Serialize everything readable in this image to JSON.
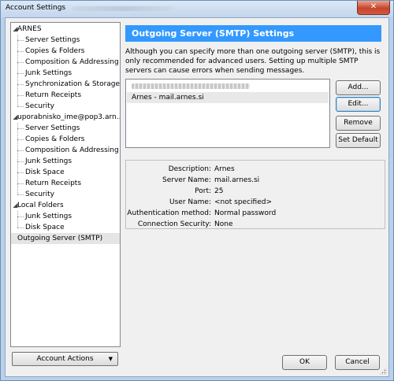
{
  "window": {
    "title": "Account Settings",
    "close_glyph": "✕"
  },
  "tree": {
    "accounts": [
      {
        "name": "ARNES",
        "children": [
          "Server Settings",
          "Copies & Folders",
          "Composition & Addressing",
          "Junk Settings",
          "Synchronization & Storage",
          "Return Receipts",
          "Security"
        ]
      },
      {
        "name": "uporabnisko_ime@pop3.arn...",
        "children": [
          "Server Settings",
          "Copies & Folders",
          "Composition & Addressing",
          "Junk Settings",
          "Disk Space",
          "Return Receipts",
          "Security"
        ]
      },
      {
        "name": "Local Folders",
        "children": [
          "Junk Settings",
          "Disk Space"
        ]
      }
    ],
    "outgoing": "Outgoing Server (SMTP)",
    "expander_glyph": "◢"
  },
  "account_actions": {
    "label": "Account Actions",
    "caret": "▼"
  },
  "smtp": {
    "heading": "Outgoing Server (SMTP) Settings",
    "description": "Although you can specify more than one outgoing server (SMTP), this is only recommended for advanced users. Setting up multiple SMTP servers can cause errors when sending messages.",
    "servers": [
      "",
      "Arnes - mail.arnes.si"
    ],
    "buttons": {
      "add": "Add...",
      "edit": "Edit...",
      "remove": "Remove",
      "set_default": "Set Default"
    },
    "details": [
      {
        "label": "Description:",
        "value": "Arnes"
      },
      {
        "label": "Server Name:",
        "value": "mail.arnes.si"
      },
      {
        "label": "Port:",
        "value": "25"
      },
      {
        "label": "User Name:",
        "value": "<not specified>"
      },
      {
        "label": "Authentication method:",
        "value": "Normal password"
      },
      {
        "label": "Connection Security:",
        "value": "None"
      }
    ]
  },
  "footer": {
    "ok": "OK",
    "cancel": "Cancel"
  }
}
